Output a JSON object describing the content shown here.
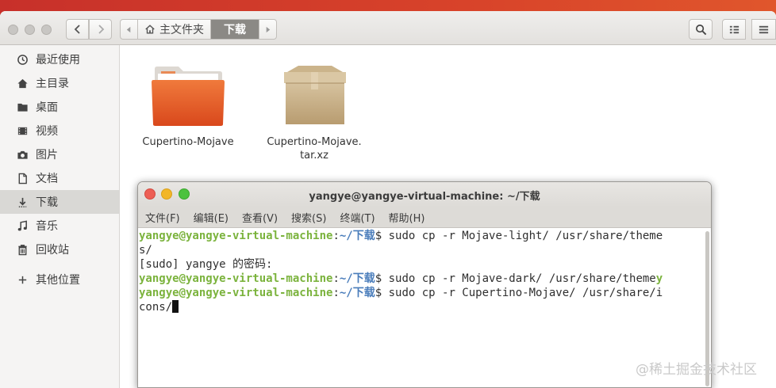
{
  "window": {
    "path": {
      "home": "主文件夹",
      "current": "下载"
    }
  },
  "sidebar": {
    "items": [
      {
        "label": "最近使用",
        "icon": "clock-icon"
      },
      {
        "label": "主目录",
        "icon": "home-icon"
      },
      {
        "label": "桌面",
        "icon": "folder-icon"
      },
      {
        "label": "视频",
        "icon": "video-icon"
      },
      {
        "label": "图片",
        "icon": "camera-icon"
      },
      {
        "label": "文档",
        "icon": "document-icon"
      },
      {
        "label": "下载",
        "icon": "download-icon",
        "active": true
      },
      {
        "label": "音乐",
        "icon": "music-icon"
      },
      {
        "label": "回收站",
        "icon": "trash-icon"
      },
      {
        "label": "其他位置",
        "icon": "plus-icon"
      }
    ]
  },
  "files": [
    {
      "name": "Cupertino-Mojave",
      "icon": "folder-icon"
    },
    {
      "name_line1": "Cupertino-Mojave.",
      "name_line2": "tar.xz",
      "icon": "archive-icon"
    }
  ],
  "terminal": {
    "title": "yangye@yangye-virtual-machine: ~/下载",
    "menu": [
      "文件(F)",
      "编辑(E)",
      "查看(V)",
      "搜索(S)",
      "终端(T)",
      "帮助(H)"
    ],
    "user": "yangye@yangye-virtual-machine",
    "path": "~/下载",
    "lines": [
      {
        "cmd": "$ sudo cp -r Mojave-light/ /usr/share/theme",
        "wrap": "s/"
      },
      {
        "plain": "[sudo] yangye 的密码:"
      },
      {
        "cmd": "$ sudo cp -r Mojave-dark/ /usr/share/theme",
        "wrap_inline": "y"
      },
      {
        "cmd": "$ sudo cp -r Cupertino-Mojave/ /usr/share/i",
        "wrap": "cons/"
      }
    ]
  },
  "watermark": "@稀土掘金技术社区",
  "colors": {
    "desktop_accent": "#d8432a",
    "prompt_user": "#7bb33d",
    "prompt_path": "#4a7dbb",
    "terminal_close": "#ed5f55",
    "terminal_min": "#f2b628",
    "terminal_max": "#4cc23e"
  }
}
